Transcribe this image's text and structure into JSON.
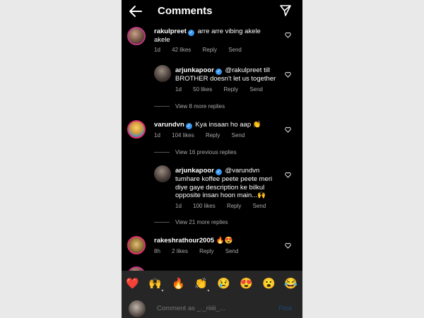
{
  "header": {
    "title": "Comments"
  },
  "comments": [
    {
      "username": "rakulpreet",
      "text": "arre arre vibing akele akele",
      "time": "1d",
      "likes": "42 likes",
      "reply": "Reply",
      "send": "Send"
    },
    {
      "username": "arjunkapoor",
      "text": "@rakulpreet till BROTHER doesn't let us together",
      "time": "1d",
      "likes": "50 likes",
      "reply": "Reply",
      "send": "Send"
    },
    {
      "username": "varundvn",
      "text": "Kya insaan ho aap 👏",
      "time": "1d",
      "likes": "104 likes",
      "reply": "Reply",
      "send": "Send"
    },
    {
      "username": "arjunkapoor",
      "text": "@varundvn tumhare koffee peete peete meri diye gaye description ke bilkul opposite insan hoon main...🙌",
      "time": "1d",
      "likes": "100 likes",
      "reply": "Reply",
      "send": "Send"
    },
    {
      "username": "rakeshrathour2005",
      "text": "🔥😍",
      "time": "8h",
      "likes": "2 likes",
      "reply": "Reply",
      "send": "Send"
    }
  ],
  "view_more": [
    "View 8 more replies",
    "View 16 previous replies",
    "View 21 more replies"
  ],
  "emojis": [
    "❤️",
    "🙌",
    "🔥",
    "👏",
    "😢",
    "😍",
    "😮",
    "😂"
  ],
  "composer": {
    "placeholder": "Comment as _._riiiii_...",
    "post": "Post"
  },
  "colors": {
    "background": "#000000",
    "accent": "#3897f0",
    "muted": "#a8a8a8",
    "panel": "#262626"
  }
}
